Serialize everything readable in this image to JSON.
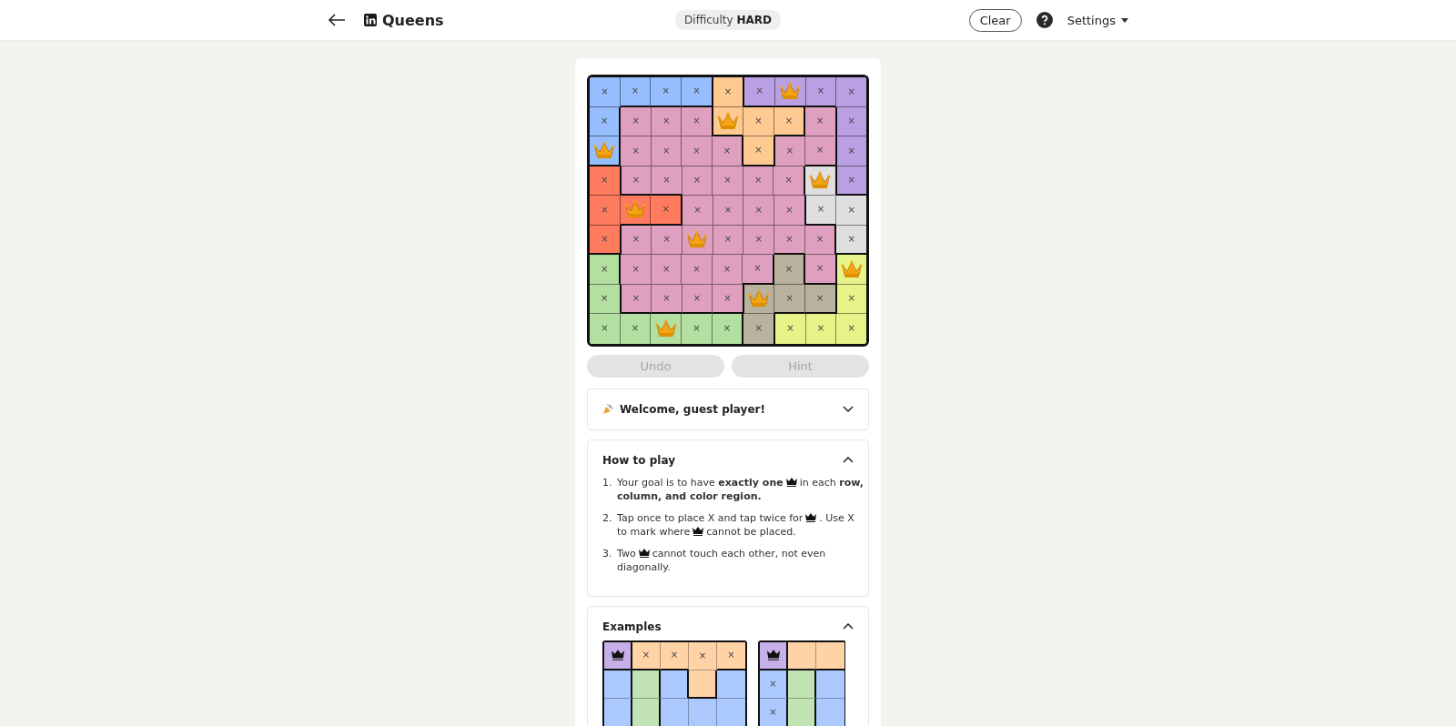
{
  "header": {
    "title": "Queens",
    "difficulty_label": "Difficulty",
    "difficulty": "HARD",
    "clear": "Clear",
    "settings": "Settings"
  },
  "board": {
    "rows": [
      [
        {
          "color": "#96bdfe",
          "kind": "x"
        },
        {
          "color": "#96bdfe",
          "kind": "x"
        },
        {
          "color": "#96bdfe",
          "kind": "x"
        },
        {
          "color": "#96bdfe",
          "kind": "x"
        },
        {
          "color": "#ffc992",
          "kind": "x"
        },
        {
          "color": "#b9a0e2",
          "kind": "x"
        },
        {
          "color": "#b9a0e2",
          "kind": "queen"
        },
        {
          "color": "#b9a0e2",
          "kind": "x"
        },
        {
          "color": "#b9a0e2",
          "kind": "x"
        }
      ],
      [
        {
          "color": "#96bdfe",
          "kind": "x"
        },
        {
          "color": "#dfa0bf",
          "kind": "x"
        },
        {
          "color": "#dfa0bf",
          "kind": "x"
        },
        {
          "color": "#dfa0bf",
          "kind": "x"
        },
        {
          "color": "#ffc992",
          "kind": "queen"
        },
        {
          "color": "#ffc992",
          "kind": "x"
        },
        {
          "color": "#ffc992",
          "kind": "x"
        },
        {
          "color": "#dfa0bf",
          "kind": "x"
        },
        {
          "color": "#b9a0e2",
          "kind": "x"
        }
      ],
      [
        {
          "color": "#96bdfe",
          "kind": "queen"
        },
        {
          "color": "#dfa0bf",
          "kind": "x"
        },
        {
          "color": "#dfa0bf",
          "kind": "x"
        },
        {
          "color": "#dfa0bf",
          "kind": "x"
        },
        {
          "color": "#dfa0bf",
          "kind": "x"
        },
        {
          "color": "#ffc992",
          "kind": "x"
        },
        {
          "color": "#dfa0bf",
          "kind": "x"
        },
        {
          "color": "#dfa0bf",
          "kind": "x"
        },
        {
          "color": "#b9a0e2",
          "kind": "x"
        }
      ],
      [
        {
          "color": "#ff7b60",
          "kind": "x"
        },
        {
          "color": "#dfa0bf",
          "kind": "x"
        },
        {
          "color": "#dfa0bf",
          "kind": "x"
        },
        {
          "color": "#dfa0bf",
          "kind": "x"
        },
        {
          "color": "#dfa0bf",
          "kind": "x"
        },
        {
          "color": "#dfa0bf",
          "kind": "x"
        },
        {
          "color": "#dfa0bf",
          "kind": "x"
        },
        {
          "color": "#dfdfdf",
          "kind": "queen"
        },
        {
          "color": "#b9a0e2",
          "kind": "x"
        }
      ],
      [
        {
          "color": "#ff7b60",
          "kind": "x"
        },
        {
          "color": "#ff7b60",
          "kind": "queen"
        },
        {
          "color": "#ff7b60",
          "kind": "x"
        },
        {
          "color": "#dfa0bf",
          "kind": "x"
        },
        {
          "color": "#dfa0bf",
          "kind": "x"
        },
        {
          "color": "#dfa0bf",
          "kind": "x"
        },
        {
          "color": "#dfa0bf",
          "kind": "x"
        },
        {
          "color": "#dfdfdf",
          "kind": "x"
        },
        {
          "color": "#dfdfdf",
          "kind": "x"
        }
      ],
      [
        {
          "color": "#ff7b60",
          "kind": "x"
        },
        {
          "color": "#dfa0bf",
          "kind": "x"
        },
        {
          "color": "#dfa0bf",
          "kind": "x"
        },
        {
          "color": "#dfa0bf",
          "kind": "queen"
        },
        {
          "color": "#dfa0bf",
          "kind": "x"
        },
        {
          "color": "#dfa0bf",
          "kind": "x"
        },
        {
          "color": "#dfa0bf",
          "kind": "x"
        },
        {
          "color": "#dfa0bf",
          "kind": "x"
        },
        {
          "color": "#dfdfdf",
          "kind": "x"
        }
      ],
      [
        {
          "color": "#b3dfa0",
          "kind": "x"
        },
        {
          "color": "#dfa0bf",
          "kind": "x"
        },
        {
          "color": "#dfa0bf",
          "kind": "x"
        },
        {
          "color": "#dfa0bf",
          "kind": "x"
        },
        {
          "color": "#dfa0bf",
          "kind": "x"
        },
        {
          "color": "#dfa0bf",
          "kind": "x"
        },
        {
          "color": "#b9b29e",
          "kind": "x"
        },
        {
          "color": "#dfa0bf",
          "kind": "x"
        },
        {
          "color": "#e6f388",
          "kind": "queen"
        }
      ],
      [
        {
          "color": "#b3dfa0",
          "kind": "x"
        },
        {
          "color": "#dfa0bf",
          "kind": "x"
        },
        {
          "color": "#dfa0bf",
          "kind": "x"
        },
        {
          "color": "#dfa0bf",
          "kind": "x"
        },
        {
          "color": "#dfa0bf",
          "kind": "x"
        },
        {
          "color": "#b9b29e",
          "kind": "queen"
        },
        {
          "color": "#b9b29e",
          "kind": "x"
        },
        {
          "color": "#b9b29e",
          "kind": "x"
        },
        {
          "color": "#e6f388",
          "kind": "x"
        }
      ],
      [
        {
          "color": "#b3dfa0",
          "kind": "x"
        },
        {
          "color": "#b3dfa0",
          "kind": "x"
        },
        {
          "color": "#b3dfa0",
          "kind": "queen"
        },
        {
          "color": "#b3dfa0",
          "kind": "x"
        },
        {
          "color": "#b3dfa0",
          "kind": "x"
        },
        {
          "color": "#b9b29e",
          "kind": "x"
        },
        {
          "color": "#e6f388",
          "kind": "x"
        },
        {
          "color": "#e6f388",
          "kind": "x"
        },
        {
          "color": "#e6f388",
          "kind": "x"
        }
      ]
    ],
    "x_text": "×"
  },
  "actions": [
    {
      "label": "Undo",
      "disabled": true
    },
    {
      "label": "Hint",
      "disabled": true
    }
  ],
  "welcome": {
    "title": "Welcome, guest player!",
    "expanded": false
  },
  "how_to_play": {
    "title": "How to play",
    "expanded": true,
    "steps": [
      {
        "number": "1.",
        "lines": [
          [
            "Your goal is to have **exactly one**",
            "in each **row,**"
          ],
          [
            "**column, and color region.**"
          ]
        ]
      },
      {
        "number": "2.",
        "lines": [
          [
            "Tap once to place X and tap twice for",
            ". Use X"
          ],
          [
            "to mark where",
            "cannot be placed."
          ]
        ]
      },
      {
        "number": "3.",
        "lines": [
          [
            "Two",
            "cannot touch each other, not even"
          ],
          [
            "diagonally."
          ]
        ]
      }
    ]
  },
  "examples": {
    "title": "Examples",
    "expanded": true,
    "grids": [
      {
        "rows": [
          [
            {
              "color": "#c7b0ea",
              "kind": "queen"
            },
            {
              "color": "#ffd3a6",
              "kind": "x"
            },
            {
              "color": "#ffd3a6",
              "kind": "x"
            },
            {
              "color": "#ffd3a6",
              "kind": "x"
            },
            {
              "color": "#ffd3a6",
              "kind": "x"
            }
          ],
          [
            {
              "color": "#abc9ff",
              "kind": "empty"
            },
            {
              "color": "#c2e3b3",
              "kind": "empty"
            },
            {
              "color": "#abc9ff",
              "kind": "empty"
            },
            {
              "color": "#ffd3a6",
              "kind": "empty"
            },
            {
              "color": "#abc9ff",
              "kind": "empty"
            }
          ],
          [
            {
              "color": "#abc9ff",
              "kind": "empty"
            },
            {
              "color": "#c2e3b3",
              "kind": "empty"
            },
            {
              "color": "#abc9ff",
              "kind": "empty"
            },
            {
              "color": "#abc9ff",
              "kind": "empty"
            },
            {
              "color": "#abc9ff",
              "kind": "empty"
            }
          ]
        ]
      },
      {
        "rows": [
          [
            {
              "color": "#c7b0ea",
              "kind": "queen"
            },
            {
              "color": "#ffd3a6",
              "kind": "empty"
            },
            {
              "color": "#ffd3a6",
              "kind": "empty"
            }
          ],
          [
            {
              "color": "#abc9ff",
              "kind": "x"
            },
            {
              "color": "#c2e3b3",
              "kind": "empty"
            },
            {
              "color": "#abc9ff",
              "kind": "empty"
            }
          ],
          [
            {
              "color": "#abc9ff",
              "kind": "x"
            },
            {
              "color": "#c2e3b3",
              "kind": "empty"
            },
            {
              "color": "#abc9ff",
              "kind": "empty"
            }
          ]
        ]
      }
    ]
  }
}
